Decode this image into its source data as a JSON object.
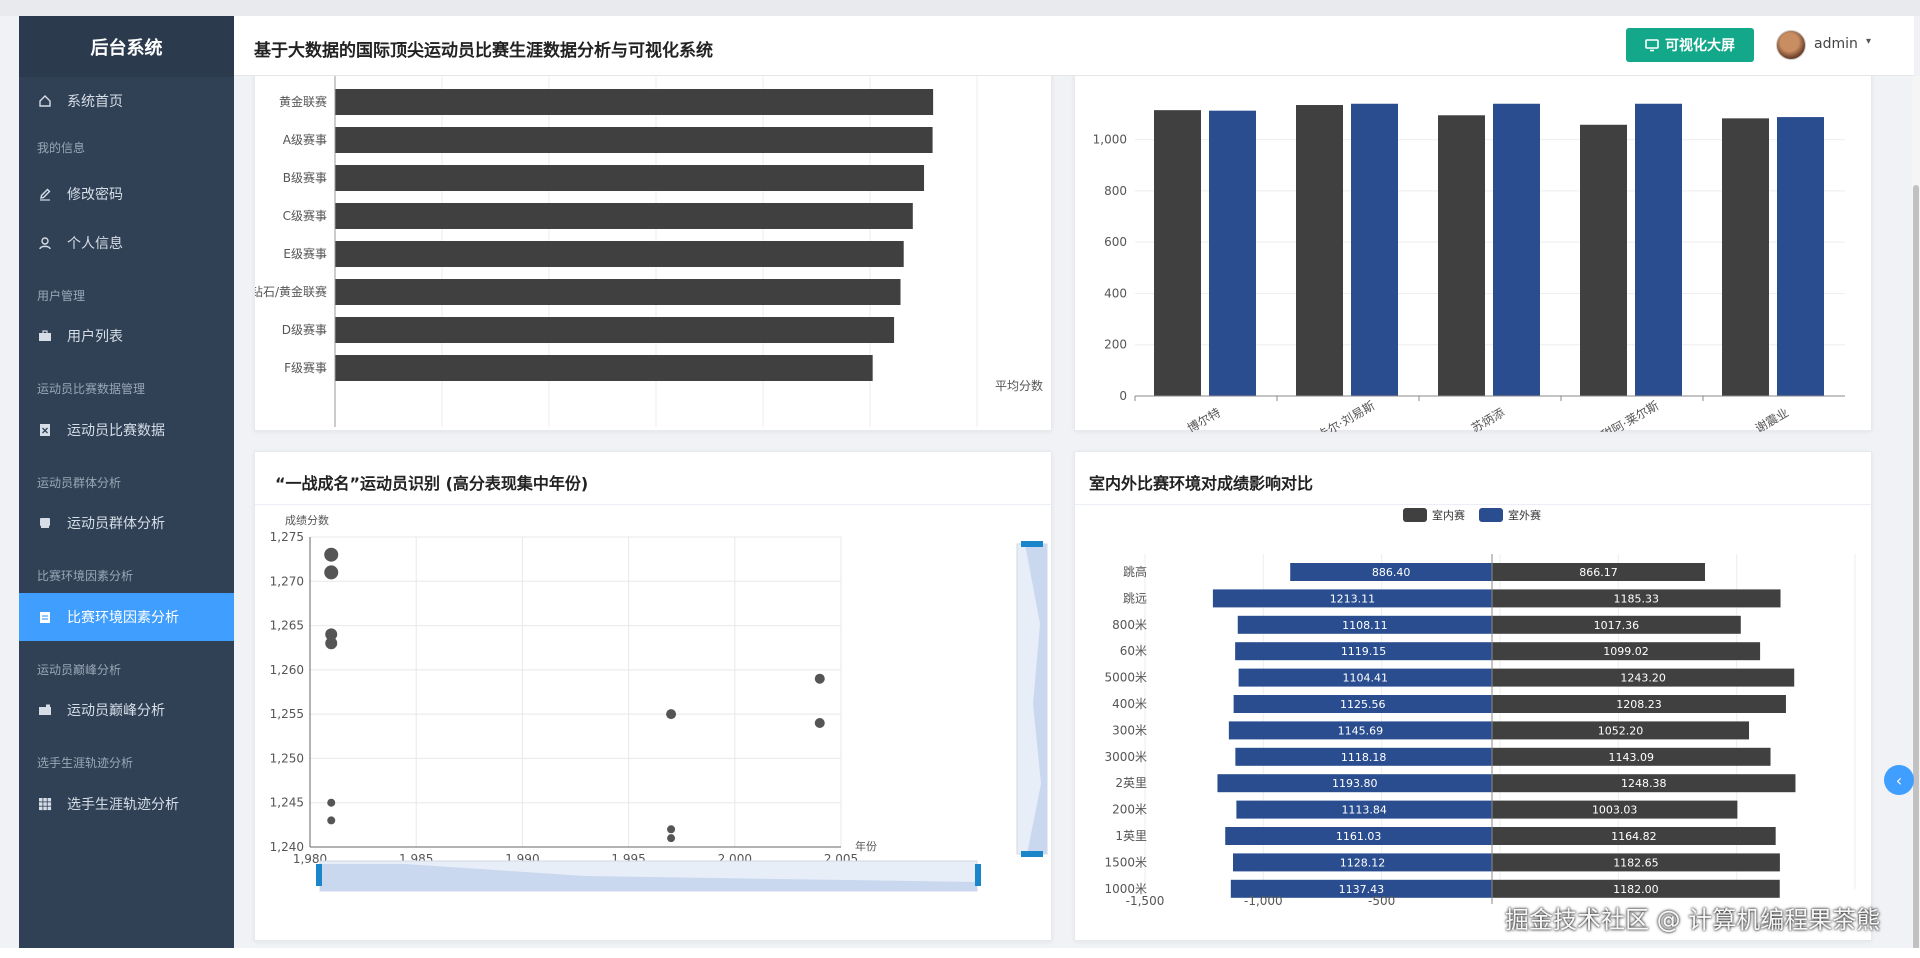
{
  "sidebar": {
    "title": "后台系统",
    "items": [
      {
        "type": "item",
        "label": "系统首页",
        "icon": "home-icon",
        "active": false
      },
      {
        "type": "group",
        "label": "我的信息"
      },
      {
        "type": "item",
        "label": "修改密码",
        "icon": "edit-icon",
        "active": false
      },
      {
        "type": "item",
        "label": "个人信息",
        "icon": "user-icon",
        "active": false
      },
      {
        "type": "group",
        "label": "用户管理"
      },
      {
        "type": "item",
        "label": "用户列表",
        "icon": "briefcase-icon",
        "active": false
      },
      {
        "type": "group",
        "label": "运动员比赛数据管理"
      },
      {
        "type": "item",
        "label": "运动员比赛数据",
        "icon": "document-icon",
        "active": false
      },
      {
        "type": "group",
        "label": "运动员群体分析"
      },
      {
        "type": "item",
        "label": "运动员群体分析",
        "icon": "printer-icon",
        "active": false
      },
      {
        "type": "group",
        "label": "比赛环境因素分析"
      },
      {
        "type": "item",
        "label": "比赛环境因素分析",
        "icon": "clipboard-icon",
        "active": true
      },
      {
        "type": "group",
        "label": "运动员巅峰分析"
      },
      {
        "type": "item",
        "label": "运动员巅峰分析",
        "icon": "camera-icon",
        "active": false
      },
      {
        "type": "group",
        "label": "选手生涯轨迹分析"
      },
      {
        "type": "item",
        "label": "选手生涯轨迹分析",
        "icon": "grid-icon",
        "active": false
      }
    ]
  },
  "header": {
    "title": "基于大数据的国际顶尖运动员比赛生涯数据分析与可视化系统",
    "bigscreen_label": "可视化大屏",
    "username": "admin",
    "caret": "▾"
  },
  "watermark": "掘金技术社区 @ 计算机编程果茶熊",
  "colors": {
    "sidebar_bg": "#304156",
    "active": "#409eff",
    "bar_dark": "#404040",
    "bar_blue": "#2a4d8f",
    "accent_green": "#13a889"
  },
  "chart_data": [
    {
      "type": "bar",
      "orientation": "horizontal",
      "categories": [
        "黄金联赛",
        "A级赛事",
        "B级赛事",
        "C级赛事",
        "E级赛事",
        "钻石/黄金联赛",
        "D级赛事",
        "F级赛事"
      ],
      "values": [
        1118,
        1117,
        1101,
        1080,
        1063,
        1057,
        1045,
        1005
      ],
      "partial_top_value": 1120,
      "xlabel": "平均分数",
      "xlim": [
        0,
        1200
      ],
      "xticks": [
        "0",
        "200",
        "400",
        "600",
        "800",
        "1,000",
        "1,200"
      ]
    },
    {
      "type": "bar",
      "categories": [
        "博尔特",
        "卡尔·刘易斯",
        "苏炳添",
        "甜阿·莱尔斯",
        "谢震业"
      ],
      "series": [
        {
          "values": [
            1115,
            1135,
            1095,
            1058,
            1083
          ]
        },
        {
          "values": [
            1113,
            1140,
            1140,
            1140,
            1088
          ]
        }
      ],
      "ylim": [
        0,
        1100
      ],
      "yticks": [
        "0",
        "200",
        "400",
        "600",
        "800",
        "1,000"
      ]
    },
    {
      "type": "scatter",
      "title": "“一战成名”运动员识别 (高分表现集中年份)",
      "ylabel": "成绩分数",
      "xlabel": "年份",
      "xlim": [
        1980,
        2005
      ],
      "ylim": [
        1240,
        1275
      ],
      "xticks": [
        "1,980",
        "1,985",
        "1,990",
        "1,995",
        "2,000",
        "2,005"
      ],
      "yticks": [
        "1,240",
        "1,245",
        "1,250",
        "1,255",
        "1,260",
        "1,265",
        "1,270",
        "1,275"
      ],
      "points": [
        {
          "x": 1981,
          "y": 1273,
          "size": 7
        },
        {
          "x": 1981,
          "y": 1271,
          "size": 7
        },
        {
          "x": 1981,
          "y": 1264,
          "size": 6
        },
        {
          "x": 1981,
          "y": 1263,
          "size": 6
        },
        {
          "x": 1981,
          "y": 1245,
          "size": 4
        },
        {
          "x": 1981,
          "y": 1243,
          "size": 4
        },
        {
          "x": 1997,
          "y": 1255,
          "size": 5
        },
        {
          "x": 1997,
          "y": 1242,
          "size": 4
        },
        {
          "x": 1997,
          "y": 1241,
          "size": 4
        },
        {
          "x": 2004,
          "y": 1259,
          "size": 5
        },
        {
          "x": 2004,
          "y": 1254,
          "size": 5
        }
      ]
    },
    {
      "type": "bar",
      "orientation": "horizontal-diverging",
      "title": "室内外比赛环境对成绩影响对比",
      "categories": [
        "跳高",
        "跳远",
        "800米",
        "60米",
        "5000米",
        "400米",
        "300米",
        "3000米",
        "2英里",
        "200米",
        "1英里",
        "1500米",
        "1000米"
      ],
      "series": [
        {
          "name": "室外赛",
          "values": [
            886.4,
            1213.11,
            1108.11,
            1119.15,
            1104.41,
            1125.56,
            1145.69,
            1118.18,
            1193.8,
            1113.84,
            1161.03,
            1128.12,
            1137.43
          ]
        },
        {
          "name": "室内赛",
          "values": [
            866.17,
            1185.33,
            1017.36,
            1099.02,
            1243.2,
            1208.23,
            1052.2,
            1143.09,
            1248.38,
            1003.03,
            1164.82,
            1182.65,
            1182.0
          ]
        }
      ],
      "legend": [
        "室内赛",
        "室外赛"
      ],
      "xlim": [
        -1500,
        1500
      ],
      "xticks": [
        "-1,500",
        "-1,000",
        "-500"
      ]
    }
  ]
}
